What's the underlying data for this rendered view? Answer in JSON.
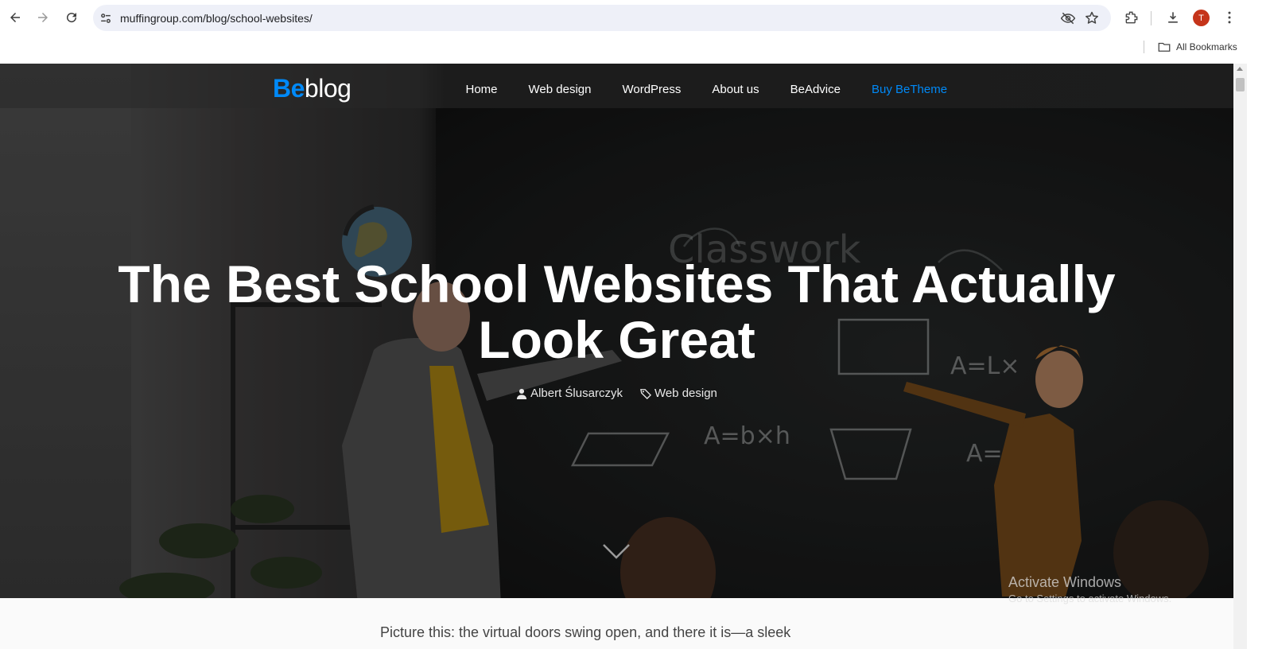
{
  "browser": {
    "url": "muffingroup.com/blog/school-websites/",
    "profile_initial": "T",
    "bookmarks_label": "All Bookmarks",
    "icons": [
      "back-icon",
      "forward-icon",
      "reload-icon",
      "site-settings-icon",
      "eye-off-icon",
      "star-icon",
      "extensions-icon",
      "download-icon",
      "menu-icon",
      "folder-icon"
    ]
  },
  "site": {
    "logo_be": "Be",
    "logo_blog": "blog",
    "brand_color": "#0089f7",
    "nav": [
      {
        "label": "Home"
      },
      {
        "label": "Web design"
      },
      {
        "label": "WordPress"
      },
      {
        "label": "About us"
      },
      {
        "label": "BeAdvice"
      },
      {
        "label": "Buy BeTheme"
      }
    ]
  },
  "hero": {
    "title_line1": "The Best School Websites That Actually",
    "title_line2": "Look Great",
    "author": "Albert Ślusarczyk",
    "category": "Web design"
  },
  "article": {
    "intro": "Picture this: the virtual doors swing open, and there it is—a sleek"
  },
  "windows_watermark": {
    "line1": "Activate Windows",
    "line2": "Go to Settings to activate Windows."
  }
}
